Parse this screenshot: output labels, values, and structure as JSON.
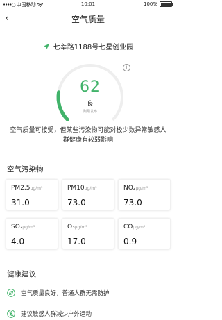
{
  "status_bar": {
    "signal": "••••○",
    "carrier": "中国移动",
    "time": "10:01",
    "battery": "100%"
  },
  "nav": {
    "back_icon": "‹",
    "title": "空气质量"
  },
  "location": {
    "icon": "location-arrow-icon",
    "address": "七莘路1188号七星创业园"
  },
  "aqi": {
    "value": "62",
    "level": "良",
    "publish_note": "刚刚发布",
    "gauge_fraction": 0.2,
    "accent_color": "#41b36a"
  },
  "description": "空气质量可接受，但某些污染物可能对极少数异常敏感人群健康有较弱影响",
  "pollutants_section": {
    "title": "空气污染物",
    "items": [
      {
        "name": "PM2.5",
        "unit": "μg/m³",
        "value": "31.0"
      },
      {
        "name": "PM10",
        "unit": "μg/m³",
        "value": "73.0"
      },
      {
        "name": "NO₂",
        "unit": "μg/m³",
        "value": "73.0"
      },
      {
        "name": "SO₂",
        "unit": "μg/m³",
        "value": "4.0"
      },
      {
        "name": "O₃",
        "unit": "μg/m³",
        "value": "17.0"
      },
      {
        "name": "CO",
        "unit": "μg/m³",
        "value": "0.9"
      }
    ]
  },
  "health_section": {
    "title": "健康建议",
    "items": [
      {
        "icon": "leaf-icon",
        "text": "空气质量良好，普通人群无需防护"
      },
      {
        "icon": "no-running-icon",
        "text": "建议敏感人群减少户外运动"
      }
    ]
  }
}
